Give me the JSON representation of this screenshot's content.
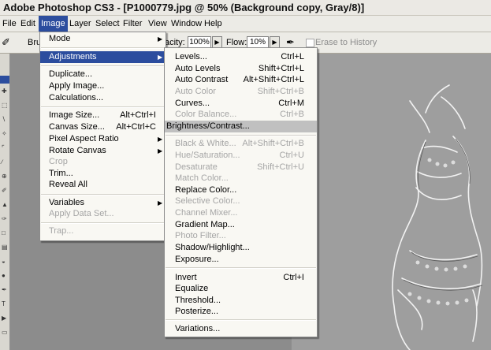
{
  "window": {
    "title": "Adobe Photoshop CS3 - [P1000779.jpg @ 50% (Background copy, Gray/8)]"
  },
  "menubar": [
    "File",
    "Edit",
    "Image",
    "Layer",
    "Select",
    "Filter",
    "View",
    "Window",
    "Help"
  ],
  "options": {
    "brush_label": "Bru",
    "opacity_label": "acity:",
    "opacity_value": "100%",
    "flow_label": "Flow:",
    "flow_value": "10%",
    "erase_label": "Erase to History"
  },
  "image_menu": {
    "groups": [
      [
        {
          "label": "Mode",
          "submenu": true
        }
      ],
      [
        {
          "label": "Adjustments",
          "submenu": true,
          "highlighted": true
        }
      ],
      [
        {
          "label": "Duplicate..."
        },
        {
          "label": "Apply Image..."
        },
        {
          "label": "Calculations..."
        }
      ],
      [
        {
          "label": "Image Size...",
          "shortcut": "Alt+Ctrl+I"
        },
        {
          "label": "Canvas Size...",
          "shortcut": "Alt+Ctrl+C"
        },
        {
          "label": "Pixel Aspect Ratio",
          "submenu": true
        },
        {
          "label": "Rotate Canvas",
          "submenu": true
        },
        {
          "label": "Crop",
          "disabled": true
        },
        {
          "label": "Trim..."
        },
        {
          "label": "Reveal All"
        }
      ],
      [
        {
          "label": "Variables",
          "submenu": true
        },
        {
          "label": "Apply Data Set...",
          "disabled": true
        }
      ],
      [
        {
          "label": "Trap...",
          "disabled": true
        }
      ]
    ]
  },
  "adjust_menu": {
    "groups": [
      [
        {
          "label": "Levels...",
          "shortcut": "Ctrl+L"
        },
        {
          "label": "Auto Levels",
          "shortcut": "Shift+Ctrl+L"
        },
        {
          "label": "Auto Contrast",
          "shortcut": "Alt+Shift+Ctrl+L"
        },
        {
          "label": "Auto Color",
          "shortcut": "Shift+Ctrl+B",
          "disabled": true
        },
        {
          "label": "Curves...",
          "shortcut": "Ctrl+M"
        },
        {
          "label": "Color Balance...",
          "shortcut": "Ctrl+B",
          "disabled": true
        },
        {
          "label": "Brightness/Contrast...",
          "highlighted": true
        }
      ],
      [
        {
          "label": "Black & White...",
          "shortcut": "Alt+Shift+Ctrl+B",
          "disabled": true
        },
        {
          "label": "Hue/Saturation...",
          "shortcut": "Ctrl+U",
          "disabled": true
        },
        {
          "label": "Desaturate",
          "shortcut": "Shift+Ctrl+U",
          "disabled": true
        },
        {
          "label": "Match Color...",
          "disabled": true
        },
        {
          "label": "Replace Color..."
        },
        {
          "label": "Selective Color...",
          "disabled": true
        },
        {
          "label": "Channel Mixer...",
          "disabled": true
        },
        {
          "label": "Gradient Map..."
        },
        {
          "label": "Photo Filter...",
          "disabled": true
        },
        {
          "label": "Shadow/Highlight..."
        },
        {
          "label": "Exposure..."
        }
      ],
      [
        {
          "label": "Invert",
          "shortcut": "Ctrl+I"
        },
        {
          "label": "Equalize"
        },
        {
          "label": "Threshold..."
        },
        {
          "label": "Posterize..."
        }
      ],
      [
        {
          "label": "Variations..."
        }
      ]
    ]
  }
}
